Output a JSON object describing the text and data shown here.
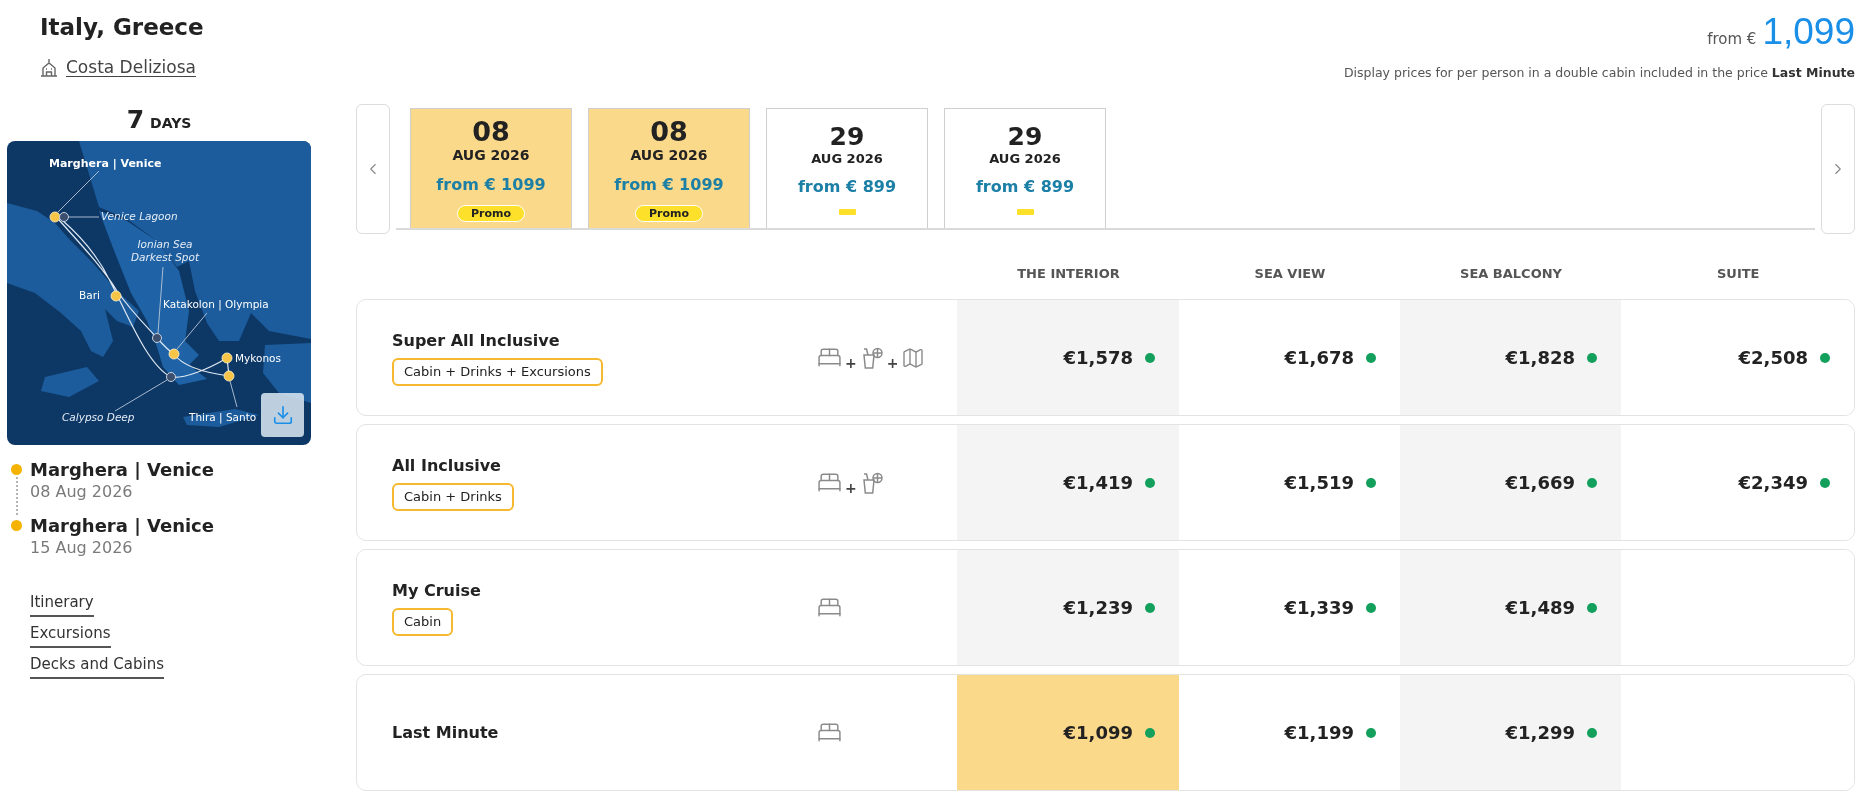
{
  "header": {
    "title": "Italy, Greece",
    "ship": "Costa Deliziosa",
    "price_prefix": "from €",
    "price": "1,099",
    "note": "Display prices for per person in a double cabin included in the price **Last Minute**"
  },
  "sidebar": {
    "duration_number": "7",
    "duration_unit": "DAYS",
    "map": {
      "labels": [
        {
          "text": "Marghera | Venice",
          "kind": "start"
        },
        {
          "text": "Venice Lagoon",
          "kind": "spot"
        },
        {
          "text": "Ionian Sea Darkest Spot",
          "kind": "spot"
        },
        {
          "text": "Bari",
          "kind": "port"
        },
        {
          "text": "Katakolon | Olympia",
          "kind": "port"
        },
        {
          "text": "Mykonos",
          "kind": "port"
        },
        {
          "text": "Calypso Deep",
          "kind": "spot"
        },
        {
          "text": "Thira | Santo",
          "kind": "port"
        }
      ]
    },
    "stops": [
      {
        "name": "Marghera | Venice",
        "date": "08 Aug 2026"
      },
      {
        "name": "Marghera | Venice",
        "date": "15 Aug 2026"
      }
    ],
    "links": [
      "Itinerary",
      "Excursions",
      "Decks and Cabins"
    ]
  },
  "dates": {
    "tabs": [
      {
        "day": "08",
        "month": "AUG 2026",
        "price": "from € 1099",
        "badge": "Promo",
        "selected": true
      },
      {
        "day": "08",
        "month": "AUG 2026",
        "price": "from € 1099",
        "badge": "Promo",
        "selected": true
      },
      {
        "day": "29",
        "month": "AUG 2026",
        "price": "from € 899",
        "selected": false
      },
      {
        "day": "29",
        "month": "AUG 2026",
        "price": "from € 899",
        "selected": false
      }
    ]
  },
  "table": {
    "columns": [
      "THE INTERIOR",
      "SEA VIEW",
      "SEA BALCONY",
      "SUITE"
    ],
    "rows": [
      {
        "name": "Super All Inclusive",
        "tag": "Cabin + Drinks + Excursions",
        "includes": [
          {
            "kind": "cabin"
          },
          {
            "kind": "plus",
            "text": "+"
          },
          {
            "kind": "drinks"
          },
          {
            "kind": "plus",
            "text": "+"
          },
          {
            "kind": "excursions"
          }
        ],
        "prices": [
          {
            "value": "€1,578",
            "available": true,
            "selected": false
          },
          {
            "value": "€1,678",
            "available": true,
            "selected": false
          },
          {
            "value": "€1,828",
            "available": true,
            "selected": false
          },
          {
            "value": "€2,508",
            "available": true,
            "selected": false
          }
        ]
      },
      {
        "name": "All Inclusive",
        "tag": "Cabin + Drinks",
        "includes": [
          {
            "kind": "cabin"
          },
          {
            "kind": "plus",
            "text": "+"
          },
          {
            "kind": "drinks"
          }
        ],
        "prices": [
          {
            "value": "€1,419",
            "available": true,
            "selected": false
          },
          {
            "value": "€1,519",
            "available": true,
            "selected": false
          },
          {
            "value": "€1,669",
            "available": true,
            "selected": false
          },
          {
            "value": "€2,349",
            "available": true,
            "selected": false
          }
        ]
      },
      {
        "name": "My Cruise",
        "tag": "Cabin",
        "includes": [
          {
            "kind": "cabin"
          }
        ],
        "prices": [
          {
            "value": "€1,239",
            "available": true,
            "selected": false
          },
          {
            "value": "€1,339",
            "available": true,
            "selected": false
          },
          {
            "value": "€1,489",
            "available": true,
            "selected": false
          }
        ]
      },
      {
        "name": "Last Minute",
        "includes": [
          {
            "kind": "cabin"
          }
        ],
        "prices": [
          {
            "value": "€1,099",
            "available": true,
            "selected": true
          },
          {
            "value": "€1,199",
            "available": true,
            "selected": false
          },
          {
            "value": "€1,299",
            "available": true,
            "selected": false
          }
        ]
      }
    ]
  }
}
